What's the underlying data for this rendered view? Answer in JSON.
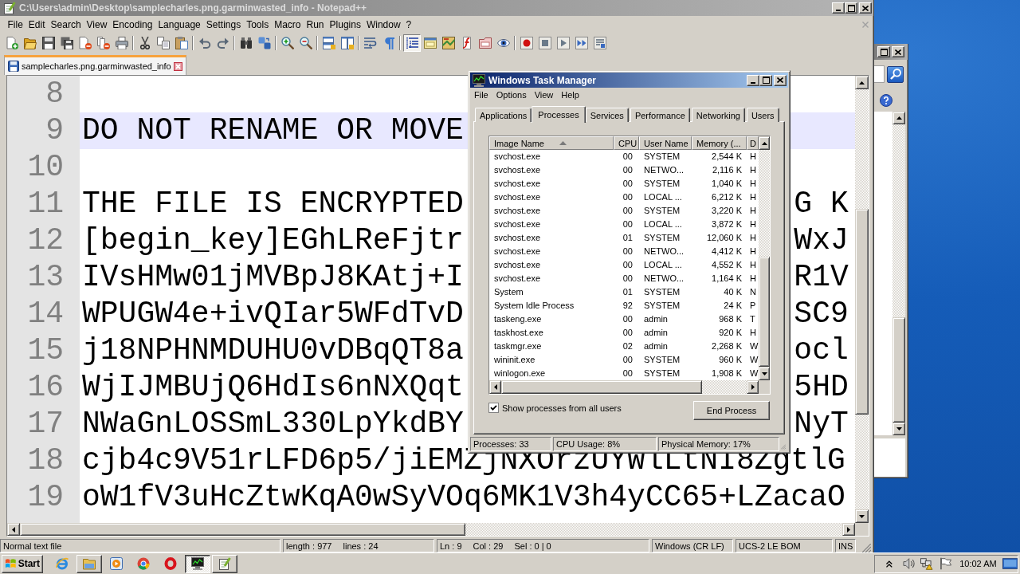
{
  "notepad": {
    "title": "C:\\Users\\admin\\Desktop\\samplecharles.png.garminwasted_info - Notepad++",
    "active": false,
    "menu": [
      "File",
      "Edit",
      "Search",
      "View",
      "Encoding",
      "Language",
      "Settings",
      "Tools",
      "Macro",
      "Run",
      "Plugins",
      "Window",
      "?"
    ],
    "toolbar": [
      {
        "buttons": [
          {
            "pressed": false
          },
          {
            "pressed": false
          },
          {
            "pressed": false
          },
          {
            "pressed": false
          },
          {
            "pressed": false
          },
          {
            "pressed": false
          },
          {
            "pressed": false
          }
        ]
      },
      {
        "buttons": [
          {
            "pressed": false
          },
          {
            "pressed": false
          },
          {
            "pressed": false
          }
        ]
      },
      {
        "buttons": [
          {
            "pressed": false
          },
          {
            "pressed": false
          }
        ]
      },
      {
        "buttons": [
          {
            "pressed": false
          },
          {
            "pressed": false
          }
        ]
      },
      {
        "buttons": [
          {
            "pressed": false
          },
          {
            "pressed": false
          }
        ]
      },
      {
        "buttons": [
          {
            "pressed": false
          },
          {
            "pressed": false
          }
        ]
      },
      {
        "buttons": [
          {
            "pressed": false
          },
          {
            "pressed": false
          }
        ]
      },
      {
        "buttons": [
          {
            "pressed": true
          },
          {
            "pressed": false
          },
          {
            "pressed": false
          },
          {
            "pressed": false
          },
          {
            "pressed": false
          },
          {
            "pressed": false
          }
        ]
      },
      {
        "buttons": [
          {
            "pressed": false
          },
          {
            "pressed": false
          },
          {
            "pressed": false
          },
          {
            "pressed": false
          },
          {
            "pressed": false
          }
        ]
      }
    ],
    "tabs": [
      {
        "label": "samplecharles.png.garminwasted_info",
        "selected": true
      }
    ],
    "editor": {
      "lines": [
        {
          "number": "8",
          "current": false
        },
        {
          "number": "9",
          "parts": [
            "DO NOT RENAME OR MOVE"
          ],
          "current": true
        },
        {
          "number": "10",
          "current": false
        },
        {
          "number": "11",
          "parts": [
            "THE FILE IS ENCRYPTED",
            "G K"
          ],
          "current": false
        },
        {
          "number": "12",
          "parts": [
            "[begin_key]EGhLReFjtr",
            "WxJ"
          ],
          "current": false
        },
        {
          "number": "13",
          "parts": [
            "IVsHMw01jMVBpJ8KAtj+I",
            "R1V"
          ],
          "current": false
        },
        {
          "number": "14",
          "parts": [
            "WPUGW4e+ivQIar5WFdTvD",
            "SC9"
          ],
          "current": false
        },
        {
          "number": "15",
          "parts": [
            "j18NPHNMDUHU0vDBqQT8a",
            "ocl"
          ],
          "current": false
        },
        {
          "number": "16",
          "parts": [
            "WjIJMBUjQ6HdIs6nNXQqt",
            "5HD"
          ],
          "current": false
        },
        {
          "number": "17",
          "parts": [
            "NWaGnLOSSmL330LpYkdBY",
            "NyT"
          ],
          "current": false
        },
        {
          "number": "18",
          "parts": [
            "cjb4c9V51rLFD6p5/jiEMZjNXOrzUYWlLtNI8ZgtlG"
          ],
          "current": false
        },
        {
          "number": "19",
          "parts": [
            "oW1fV3uHcZtwKqA0wSyVOq6MK1V3h4yCC65+LZacaO"
          ],
          "current": false
        }
      ]
    },
    "status_bar": [
      [
        "Normal text file"
      ],
      [
        "length : 977",
        "lines : 24"
      ],
      [
        "Ln : 9",
        "Col : 29",
        "Sel : 0 | 0"
      ],
      [
        "Windows (CR LF)"
      ],
      [
        "UCS-2 LE BOM"
      ],
      [
        "INS"
      ]
    ]
  },
  "task_manager": {
    "title": "Windows Task Manager",
    "active": true,
    "menu": [
      "File",
      "Options",
      "View",
      "Help"
    ],
    "tabs": [
      {
        "label": "Applications",
        "selected": false
      },
      {
        "label": "Processes",
        "selected": true
      },
      {
        "label": "Services",
        "selected": false
      },
      {
        "label": "Performance",
        "selected": false
      },
      {
        "label": "Networking",
        "selected": false
      },
      {
        "label": "Users",
        "selected": false
      }
    ],
    "table": {
      "columns": [
        {
          "label": "Image Name",
          "sorted": true
        },
        {
          "label": "CPU",
          "sorted": false
        },
        {
          "label": "User Name",
          "sorted": false
        },
        {
          "label": "Memory (...",
          "sorted": false
        },
        {
          "label": "D",
          "sorted": false
        }
      ],
      "rows": [
        {
          "cells": [
            "svchost.exe",
            "00",
            "SYSTEM",
            "2,544 K",
            "H"
          ],
          "selected": false
        },
        {
          "cells": [
            "svchost.exe",
            "00",
            "NETWO...",
            "2,116 K",
            "H"
          ],
          "selected": false
        },
        {
          "cells": [
            "svchost.exe",
            "00",
            "SYSTEM",
            "1,040 K",
            "H"
          ],
          "selected": false
        },
        {
          "cells": [
            "svchost.exe",
            "00",
            "LOCAL ...",
            "6,212 K",
            "H"
          ],
          "selected": false
        },
        {
          "cells": [
            "svchost.exe",
            "00",
            "SYSTEM",
            "3,220 K",
            "H"
          ],
          "selected": false
        },
        {
          "cells": [
            "svchost.exe",
            "00",
            "LOCAL ...",
            "3,872 K",
            "H"
          ],
          "selected": false
        },
        {
          "cells": [
            "svchost.exe",
            "01",
            "SYSTEM",
            "12,060 K",
            "H"
          ],
          "selected": false
        },
        {
          "cells": [
            "svchost.exe",
            "00",
            "NETWO...",
            "4,412 K",
            "H"
          ],
          "selected": false
        },
        {
          "cells": [
            "svchost.exe",
            "00",
            "LOCAL ...",
            "4,552 K",
            "H"
          ],
          "selected": false
        },
        {
          "cells": [
            "svchost.exe",
            "00",
            "NETWO...",
            "1,164 K",
            "H"
          ],
          "selected": false
        },
        {
          "cells": [
            "System",
            "01",
            "SYSTEM",
            "40 K",
            "N"
          ],
          "selected": false
        },
        {
          "cells": [
            "System Idle Process",
            "92",
            "SYSTEM",
            "24 K",
            "P"
          ],
          "selected": false
        },
        {
          "cells": [
            "taskeng.exe",
            "00",
            "admin",
            "968 K",
            "T"
          ],
          "selected": false
        },
        {
          "cells": [
            "taskhost.exe",
            "00",
            "admin",
            "920 K",
            "H"
          ],
          "selected": false
        },
        {
          "cells": [
            "taskmgr.exe",
            "02",
            "admin",
            "2,268 K",
            "W"
          ],
          "selected": false
        },
        {
          "cells": [
            "wininit.exe",
            "00",
            "SYSTEM",
            "960 K",
            "W"
          ],
          "selected": false
        },
        {
          "cells": [
            "winlogon.exe",
            "00",
            "SYSTEM",
            "1,908 K",
            "W"
          ],
          "selected": false
        }
      ]
    },
    "show_all_users": {
      "label": "Show processes from all users",
      "checked": true
    },
    "end_process_button": "End Process",
    "status_bar": [
      "Processes: 33",
      "CPU Usage: 8%",
      "Physical Memory: 17%"
    ]
  },
  "side_window": {
    "active": false
  },
  "taskbar": {
    "start": "Start",
    "items": [
      {
        "running": false,
        "selected": false
      },
      {
        "running": true,
        "selected": false
      },
      {
        "running": false,
        "selected": false
      },
      {
        "running": false,
        "selected": false
      },
      {
        "running": false,
        "selected": false
      },
      {
        "running": true,
        "selected": true
      },
      {
        "running": true,
        "selected": false
      }
    ],
    "clock": "10:02 AM"
  }
}
